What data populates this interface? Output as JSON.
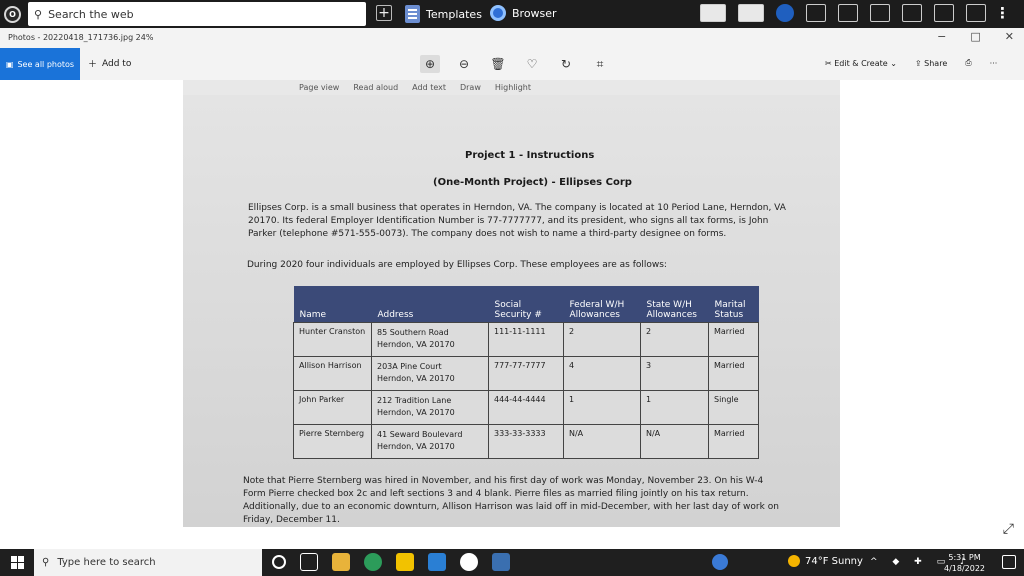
{
  "top_taskbar": {
    "search_text": "Search the web",
    "new_tab": "+",
    "templates": "Templates",
    "browser": "Browser",
    "more": "⋮"
  },
  "window": {
    "title": "Photos - 20220418_171736.jpg  24%",
    "minimize": "−",
    "restore": "□",
    "close": "✕"
  },
  "toolbar": {
    "see_all_photos": "See all photos",
    "add_to": "Add to",
    "edit_create": "Edit & Create",
    "share": "Share",
    "more": "···"
  },
  "photo": {
    "doc_toolbar": {
      "page_view": "Page view",
      "read_aloud": "Read aloud",
      "add_text": "Add text",
      "draw": "Draw",
      "highlight": "Highlight"
    },
    "title1": "Project 1 - Instructions",
    "title2": "(One-Month Project) - Ellipses Corp",
    "para1_l1": "Ellipses Corp. is a small business that operates in Herndon, VA. The company is located at 10 Period Lane, Herndon, VA",
    "para1_l2": "20170. Its federal Employer Identification Number is 77-7777777, and its president, who signs all tax forms, is John",
    "para1_l3": "Parker (telephone #571-555-0073). The company does not wish to name a third-party designee on forms.",
    "para2": "During 2020 four individuals are employed by Ellipses Corp. These employees are as follows:",
    "table": {
      "headers": [
        "Name",
        "Address",
        "Social Security #",
        "Federal W/H Allowances",
        "State W/H Allowances",
        "Marital Status"
      ],
      "rows": [
        {
          "name": "Hunter Cranston",
          "addr1": "85 Southern Road",
          "addr2": "Herndon, VA 20170",
          "ssn": "111-11-1111",
          "fed": "2",
          "state": "2",
          "status": "Married"
        },
        {
          "name": "Allison Harrison",
          "addr1": "203A Pine Court",
          "addr2": "Herndon, VA 20170",
          "ssn": "777-77-7777",
          "fed": "4",
          "state": "3",
          "status": "Married"
        },
        {
          "name": "John Parker",
          "addr1": "212 Tradition Lane",
          "addr2": "Herndon, VA 20170",
          "ssn": "444-44-4444",
          "fed": "1",
          "state": "1",
          "status": "Single"
        },
        {
          "name": "Pierre Sternberg",
          "addr1": "41 Seward Boulevard",
          "addr2": "Herndon, VA 20170",
          "ssn": "333-33-3333",
          "fed": "N/A",
          "state": "N/A",
          "status": "Married"
        }
      ]
    },
    "note_l1": "Note that Pierre Sternberg was hired in November, and his first day of work was Monday, November 23. On his W-4",
    "note_l2": "Form Pierre checked box 2c and left sections 3 and 4 blank. Pierre files as married filing jointly on his tax return.",
    "note_l3": "Additionally, due to an economic downturn, Allison Harrison was laid off in mid-December, with her last day of work on",
    "note_l4": "Friday, December 11."
  },
  "taskbar": {
    "search_placeholder": "Type here to search",
    "weather": "74°F  Sunny",
    "time": "5:31 PM",
    "date": "4/18/2022"
  }
}
